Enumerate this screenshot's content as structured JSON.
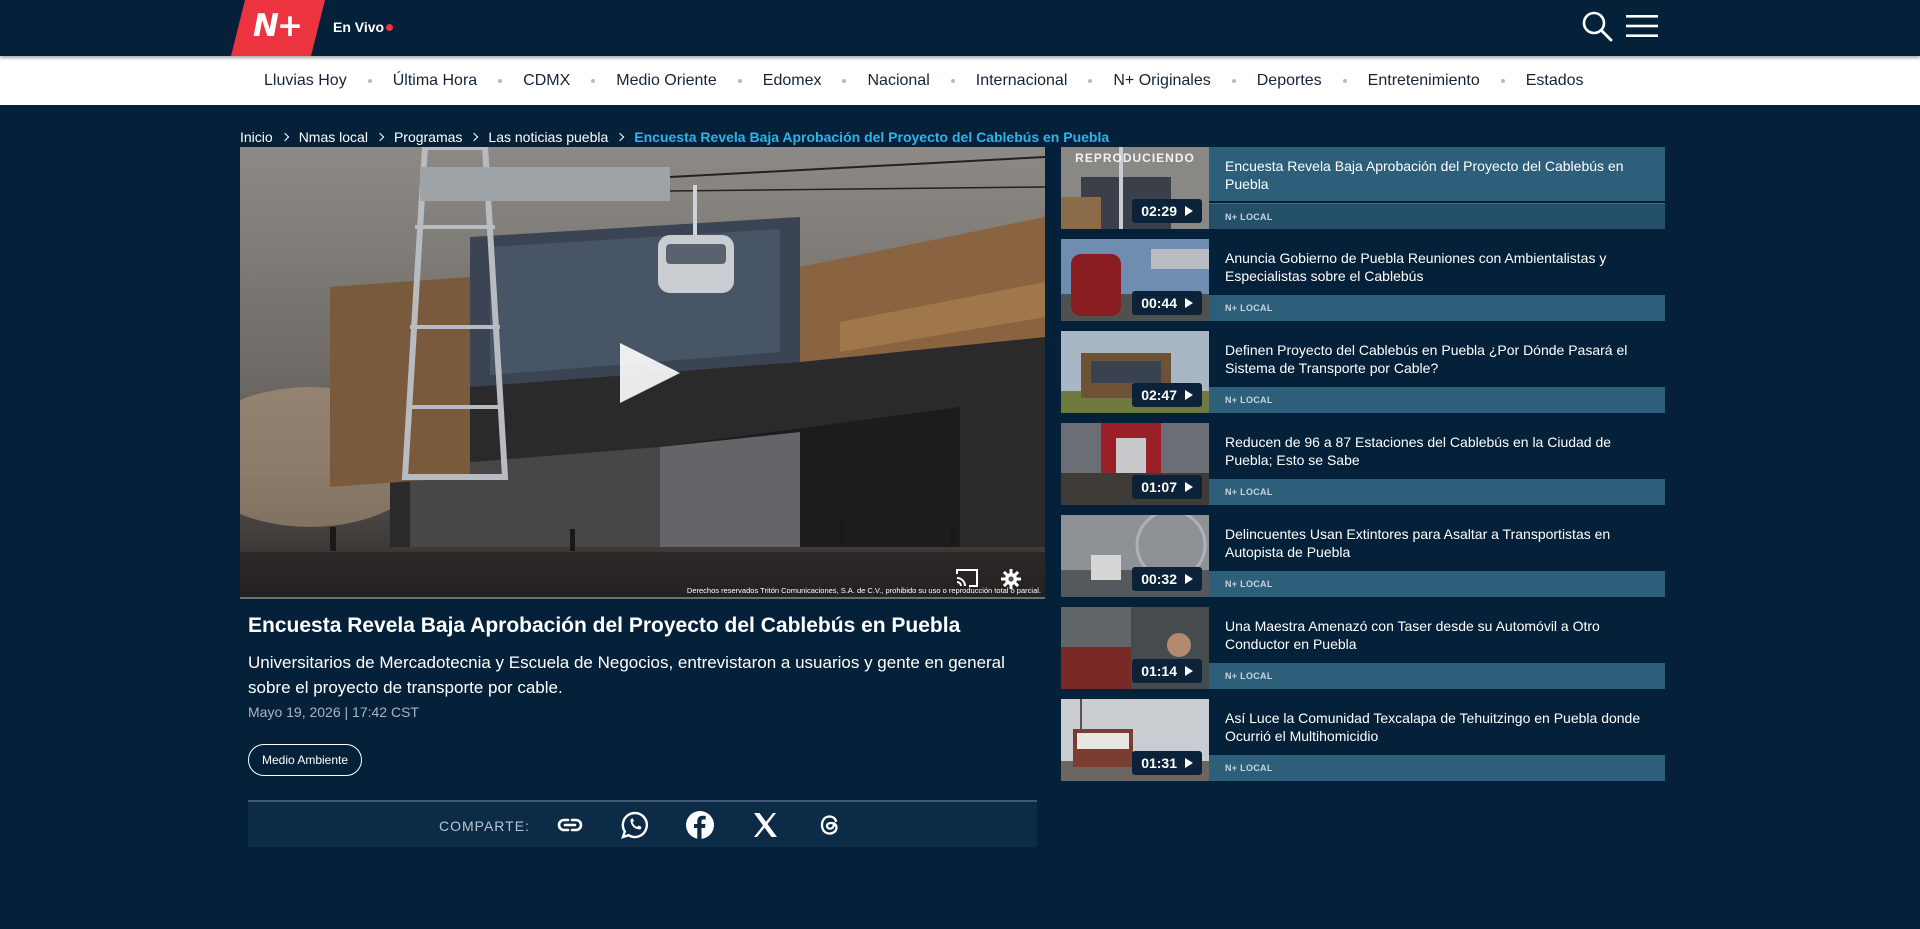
{
  "header": {
    "logo_text": "N+",
    "live_label": "En Vivo",
    "search_icon": "search-icon",
    "menu_icon": "hamburger-menu-icon",
    "brand_color": "#ec3340"
  },
  "nav": {
    "items": [
      "Lluvias Hoy",
      "Última Hora",
      "CDMX",
      "Medio Oriente",
      "Edomex",
      "Nacional",
      "Internacional",
      "N+ Originales",
      "Deportes",
      "Entretenimiento",
      "Estados"
    ]
  },
  "breadcrumb": {
    "items": [
      "Inicio",
      "Nmas local",
      "Programas",
      "Las noticias puebla"
    ],
    "current": "Encuesta Revela Baja Aprobación del Proyecto del Cablebús en Puebla"
  },
  "player": {
    "copyright": "Derechos reservados Tritón Comunicaciones, S.A. de C.V., prohibido su uso o reproducción total o parcial.",
    "progress": 0,
    "controls": [
      "play-icon",
      "cast-icon",
      "settings-icon"
    ]
  },
  "article": {
    "title": "Encuesta Revela Baja Aprobación del Proyecto del Cablebús en Puebla",
    "summary": "Universitarios de Mercadotecnia y Escuela de Negocios, entrevistaron a usuarios y gente en general sobre el proyecto de transporte por cable.",
    "date": "Mayo 19, 2026 | 17:42 CST",
    "tag": "Medio Ambiente"
  },
  "share": {
    "label": "COMPARTE:",
    "icons": [
      "link-icon",
      "whatsapp-icon",
      "facebook-icon",
      "x-icon",
      "threads-icon"
    ]
  },
  "playlist": {
    "now_playing_label": "REPRODUCIENDO",
    "items": [
      {
        "title": "Encuesta Revela Baja Aprobación del Proyecto del Cablebús en Puebla",
        "duration": "02:29",
        "label": "N+ LOCAL"
      },
      {
        "title": "Anuncia Gobierno de Puebla Reuniones con Ambientalistas y Especialistas sobre el Cablebús",
        "duration": "00:44",
        "label": "N+ LOCAL"
      },
      {
        "title": "Definen Proyecto del Cablebús en Puebla ¿Por Dónde Pasará el Sistema de Transporte por Cable?",
        "duration": "02:47",
        "label": "N+ LOCAL"
      },
      {
        "title": "Reducen de 96 a 87 Estaciones del Cablebús en la Ciudad de Puebla; Esto se Sabe",
        "duration": "01:07",
        "label": "N+ LOCAL"
      },
      {
        "title": "Delincuentes Usan Extintores para Asaltar a Transportistas en Autopista de Puebla",
        "duration": "00:32",
        "label": "N+ LOCAL"
      },
      {
        "title": "Una Maestra Amenazó con Taser desde su Automóvil a Otro Conductor en Puebla",
        "duration": "01:14",
        "label": "N+ LOCAL"
      },
      {
        "title": "Así Luce la Comunidad Texcalapa de Tehuitzingo en Puebla donde Ocurrió el Multihomicidio",
        "duration": "01:31",
        "label": "N+ LOCAL"
      }
    ]
  }
}
